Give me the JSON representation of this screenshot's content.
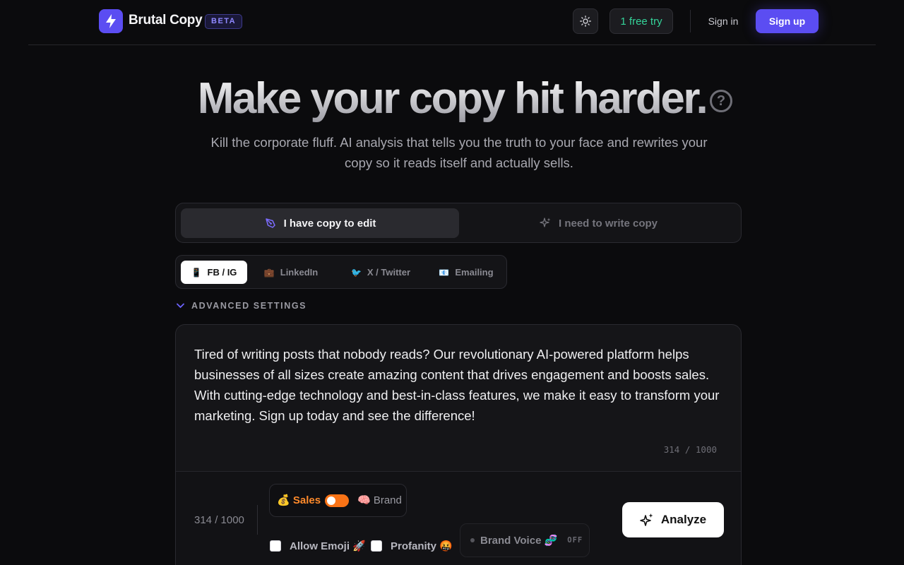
{
  "header": {
    "brand": "Brutal Copy",
    "badge": "BETA",
    "free_try": "1 free try",
    "sign_in": "Sign in",
    "sign_up": "Sign up",
    "accent": "#5b4df2"
  },
  "hero": {
    "title": "Make your copy hit harder.",
    "help": "?",
    "subtitle": "Kill the corporate fluff. AI analysis that tells you the truth to your face and rewrites your copy so it reads itself and actually sells."
  },
  "modes": {
    "edit_label": "I have copy to edit",
    "write_label": "I need to write copy"
  },
  "platforms": [
    {
      "emoji": "📱",
      "label": "FB / IG"
    },
    {
      "emoji": "💼",
      "label": "LinkedIn"
    },
    {
      "emoji": "🐦",
      "label": "X / Twitter"
    },
    {
      "emoji": "📧",
      "label": "Emailing"
    }
  ],
  "advanced": {
    "label": "ADVANCED SETTINGS"
  },
  "editor": {
    "text": "Tired of writing posts that nobody reads? Our revolutionary AI-powered platform helps businesses of all sizes create amazing content that drives engagement and boosts sales. With cutting-edge technology and best-in-class features, we make it easy to transform your marketing. Sign up today and see the difference!",
    "counter_top": "314 / 1000",
    "counter_bottom": "314 / 1000"
  },
  "controls": {
    "sales": "💰 Sales",
    "brand": "🧠 Brand",
    "sales_color": "#f97316",
    "allow_emoji": "Allow Emoji 🚀",
    "profanity": "Profanity 🤬",
    "brand_voice": "Brand Voice 🧬",
    "brand_voice_state": "OFF",
    "analyze": "Analyze"
  }
}
